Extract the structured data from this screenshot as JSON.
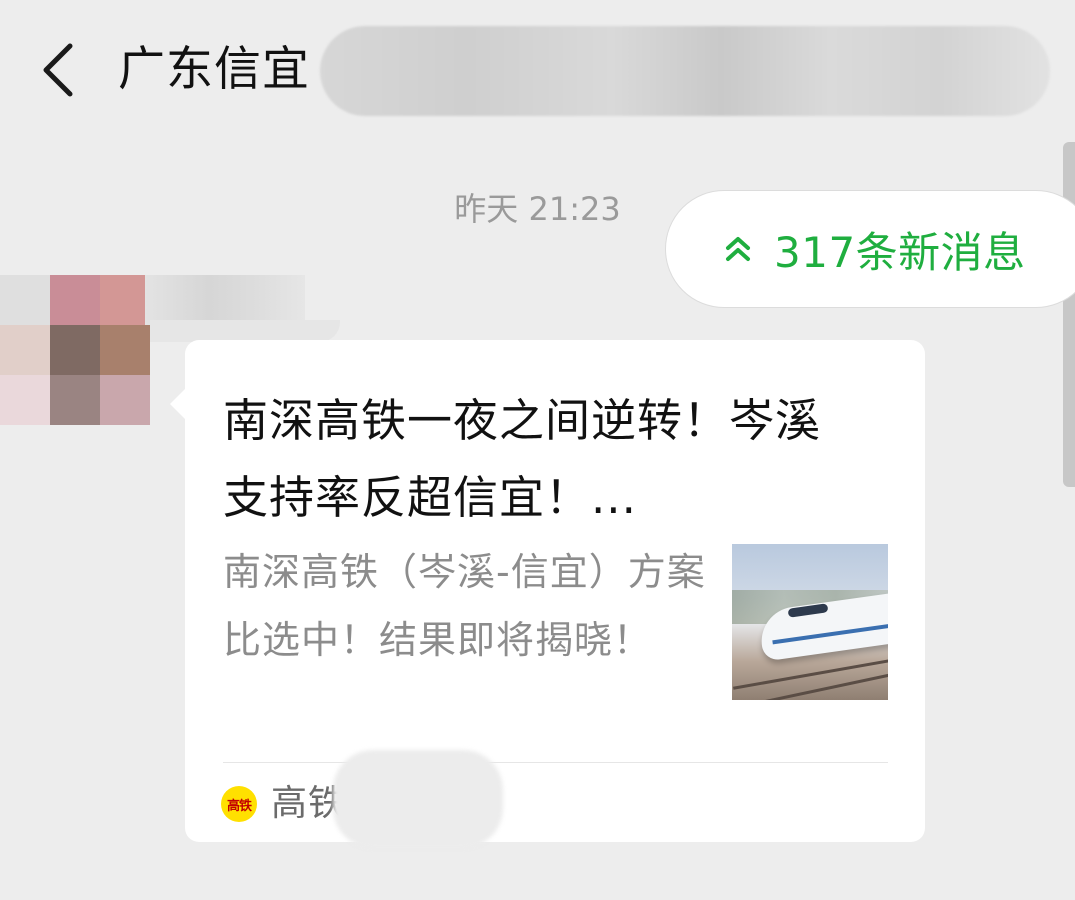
{
  "header": {
    "title": "广东信宜",
    "back_icon": "chevron-left-icon"
  },
  "chat": {
    "timestamp": "昨天 21:23",
    "new_messages_label": "317条新消息",
    "new_messages_icon": "double-chevron-up-icon",
    "accent_color": "#1fae3f"
  },
  "card": {
    "title": "南深高铁一夜之间逆转！岑溪支持率反超信宜！...",
    "description": "南深高铁（岑溪-信宜）方案比选中！结果即将揭晓！",
    "source_icon_text": "高铁",
    "source_name": "高铁"
  }
}
